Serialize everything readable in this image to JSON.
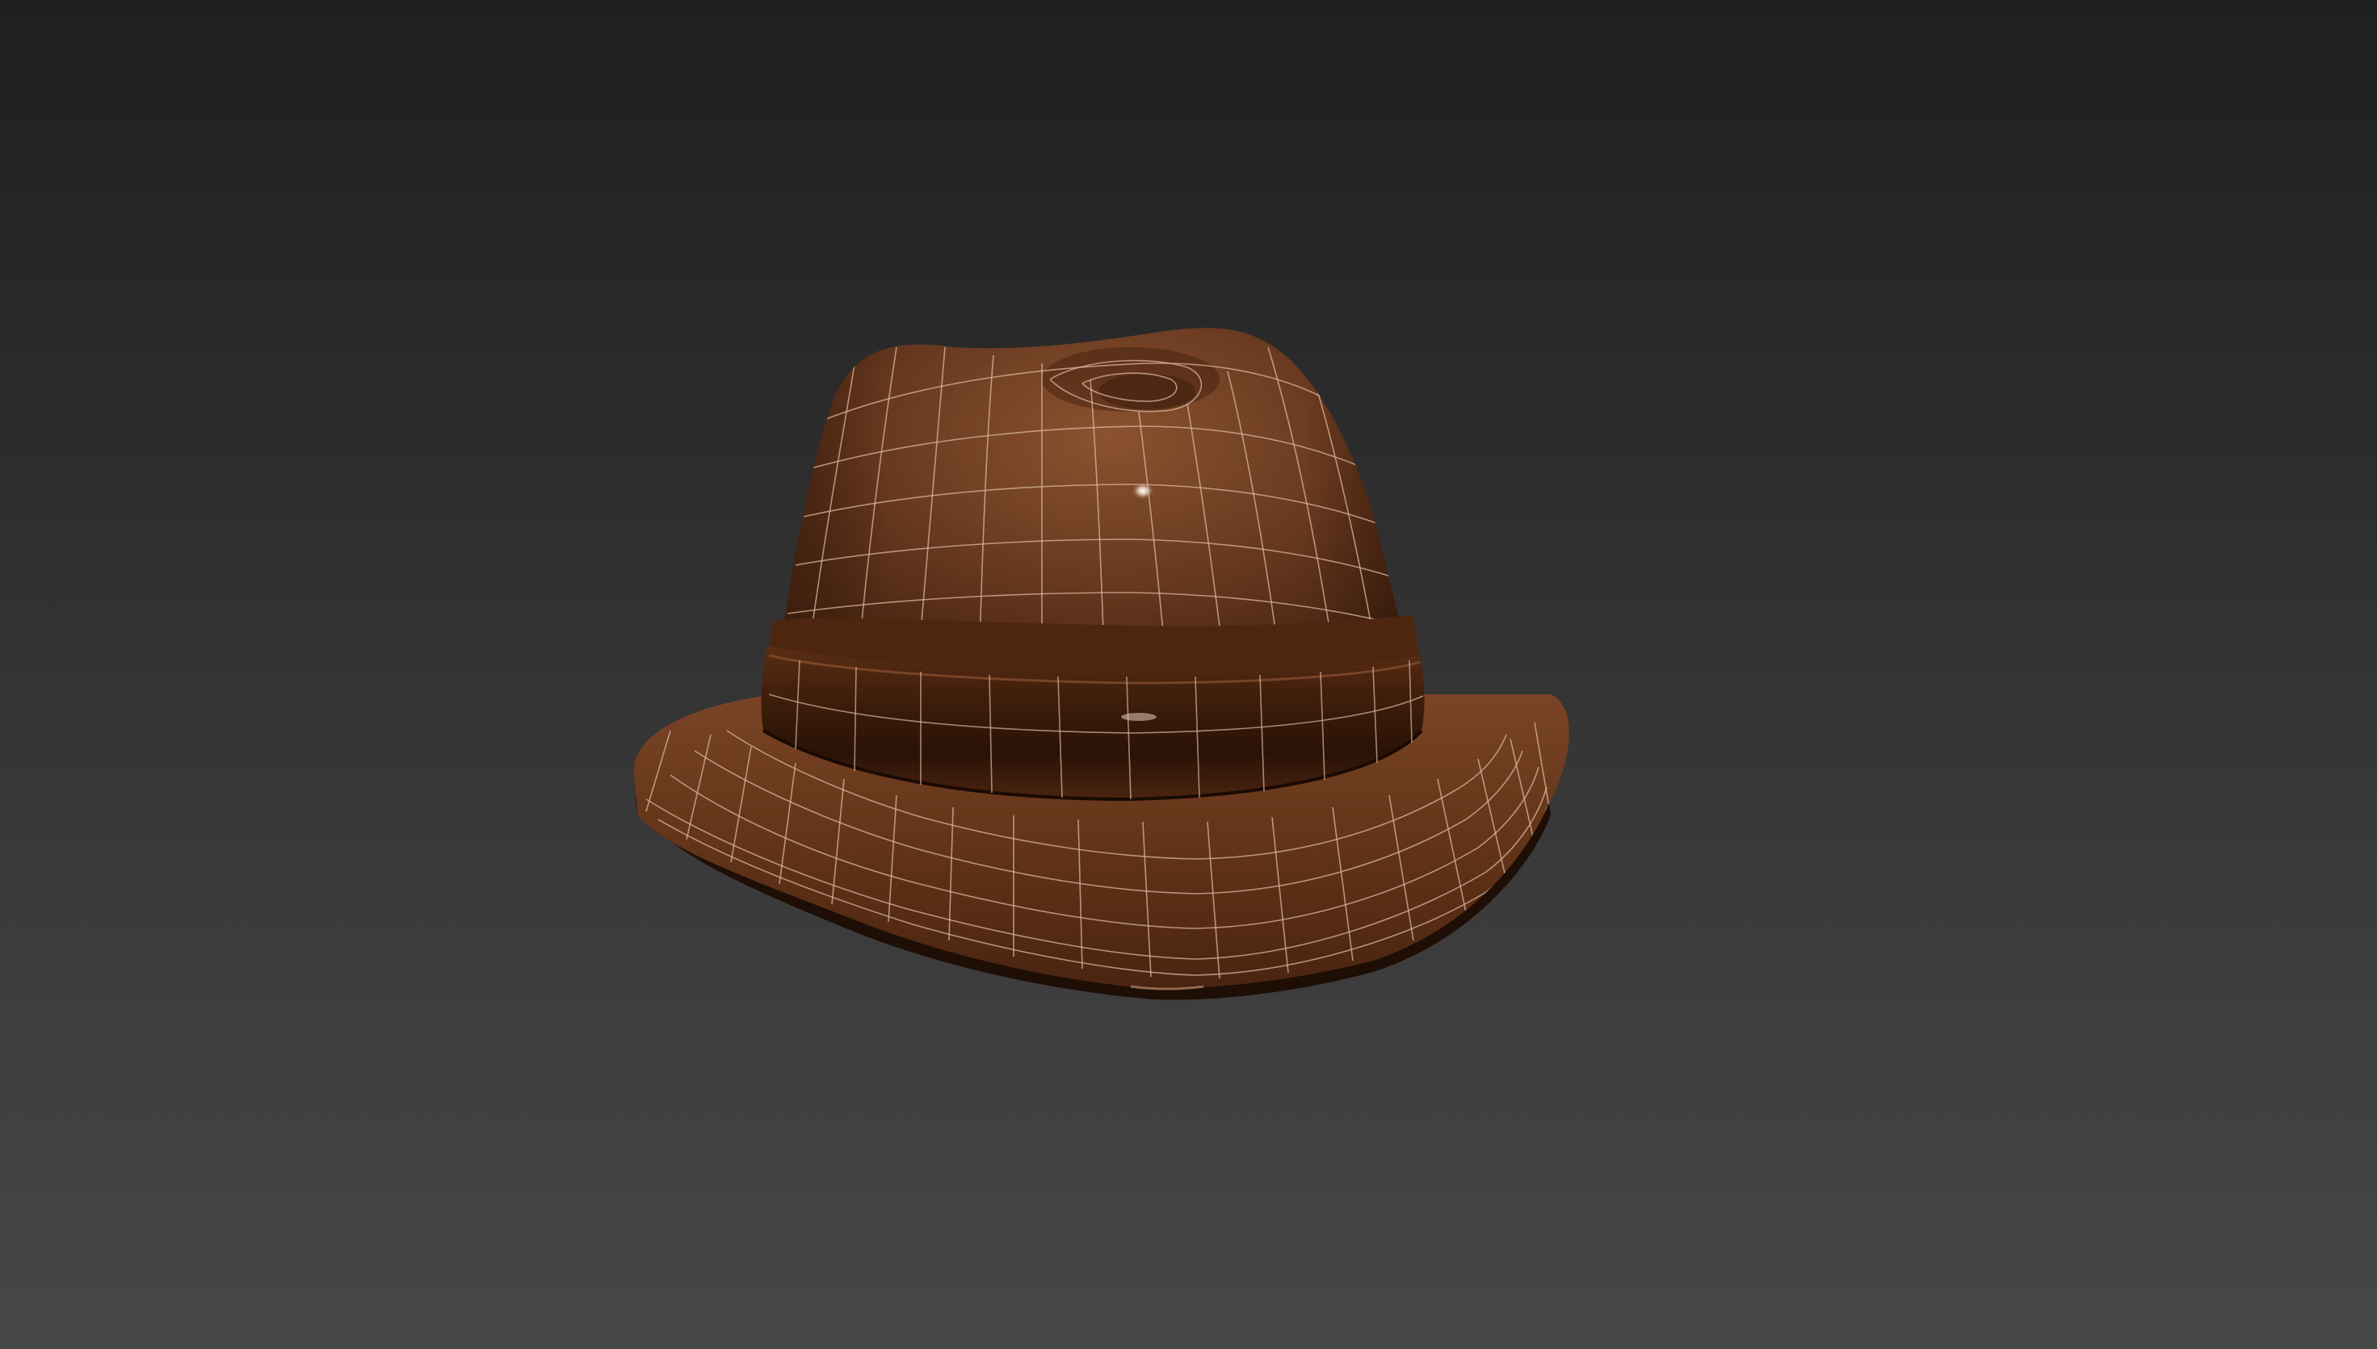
{
  "viewport": {
    "background_top": "#1f1f1f",
    "background_bottom": "#474747",
    "shading_mode": "smooth-shaded-with-wireframe-edges"
  },
  "model": {
    "object": "fedora-hat",
    "material_color": "#6a3a20",
    "material_dark": "#2e1608",
    "material_highlight": "#8a5230",
    "wire_color": "#d9b7a0",
    "parts": [
      "crown",
      "hat-band",
      "brim"
    ]
  }
}
